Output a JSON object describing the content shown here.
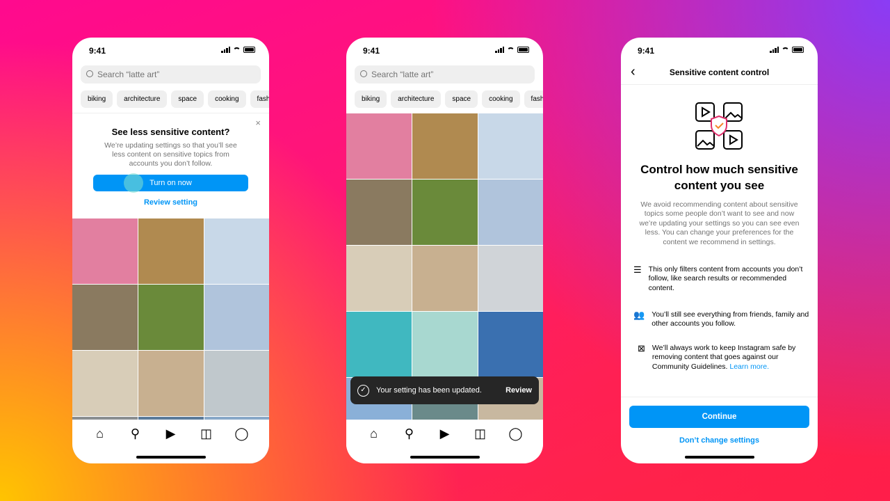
{
  "status_time": "9:41",
  "search_placeholder": "Search “latte art”",
  "chips": [
    "biking",
    "architecture",
    "space",
    "cooking",
    "fash"
  ],
  "prompt": {
    "title": "See less sensitive content?",
    "body": "We’re updating settings so that you’ll see less content on sensitive topics from accounts you don’t follow.",
    "primary": "Turn on now",
    "secondary": "Review setting",
    "close": "×"
  },
  "toast": {
    "message": "Your setting has been updated.",
    "action": "Review"
  },
  "grid1_colors": [
    "#e27fa0",
    "#b08a50",
    "#c8d8e8",
    "#8a7a60",
    "#6a8a3a",
    "#b0c4dc",
    "#d8cdb8",
    "#c8b090",
    "#c0c8cc",
    "#8a8e90",
    "#5a7a9a",
    "#88a8c8"
  ],
  "grid2_colors": [
    "#e27fa0",
    "#b08a50",
    "#c8d8e8",
    "#8a7a60",
    "#6a8a3a",
    "#b0c4dc",
    "#d8cdb8",
    "#c8b090",
    "#d0d4d8",
    "#40b8c0",
    "#a8d8d0",
    "#3a70b0",
    "#8ab0d8",
    "#6a8a8a",
    "#c8b8a0"
  ],
  "control": {
    "header": "Sensitive content control",
    "back": "‹",
    "title": "Control how much sensitive content you see",
    "intro": "We avoid recommending content about sensitive topics some people don’t want to see and now we’re updating your settings so you can see even less. You can change your preferences for the content we recommend in settings.",
    "items": [
      {
        "icon": "sliders-icon",
        "text": "This only filters content from accounts you don’t follow, like search results or recommended content."
      },
      {
        "icon": "people-icon",
        "text": "You’ll still see everything from friends, family and other accounts you follow."
      },
      {
        "icon": "hidden-image-icon",
        "text": "We’ll always work to keep Instagram safe by removing content that goes against our Community Guidelines.",
        "link": "Learn more."
      }
    ],
    "continue": "Continue",
    "dont_change": "Don’t change settings"
  },
  "nav": [
    "⌂",
    "⚲",
    "▶",
    "◫",
    "◯"
  ],
  "colors": {
    "accent": "#0095f6",
    "toast_bg": "#262626"
  }
}
